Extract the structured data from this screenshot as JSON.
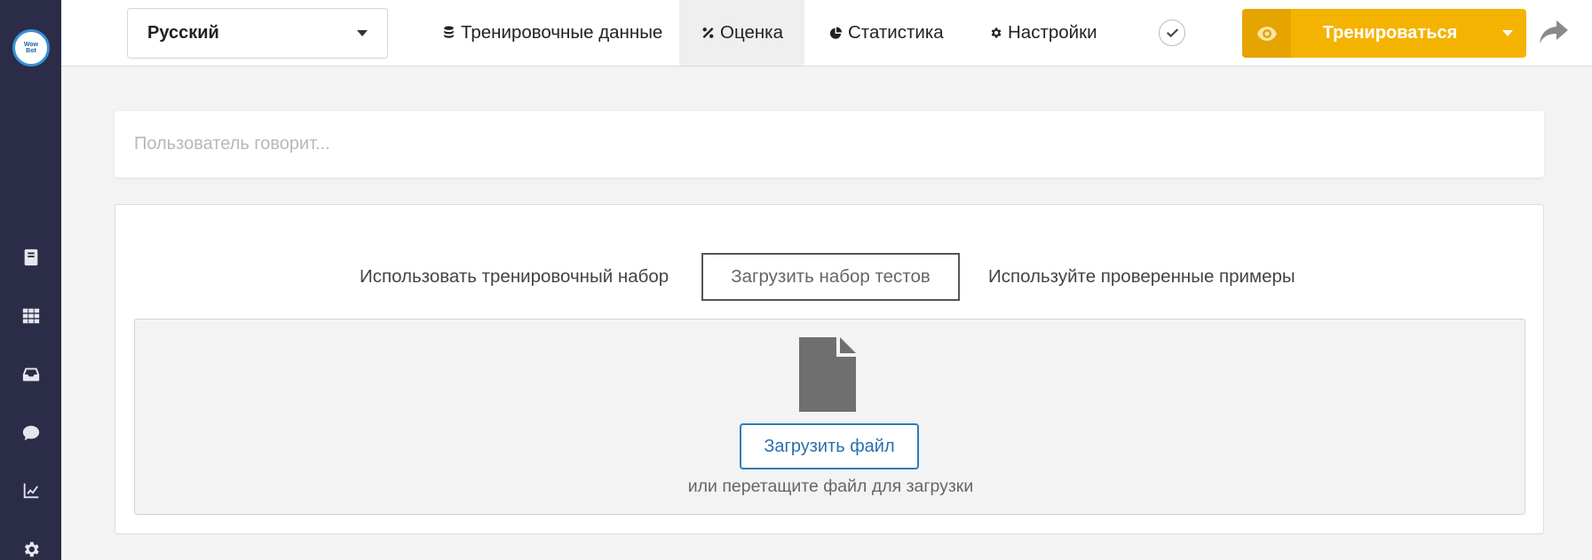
{
  "sidebar": {
    "logo_text": "Wow Bot",
    "items": [
      {
        "icon": "book-icon"
      },
      {
        "icon": "grid-icon"
      },
      {
        "icon": "inbox-icon"
      },
      {
        "icon": "chat-icon"
      },
      {
        "icon": "chart-icon"
      },
      {
        "icon": "gear-icon"
      }
    ]
  },
  "header": {
    "language": "Русский",
    "tabs": [
      {
        "label": "Тренировочные данные",
        "icon": "database-icon"
      },
      {
        "label": "Оценка",
        "icon": "percent-icon",
        "active": true
      },
      {
        "label": "Статистика",
        "icon": "pie-chart-icon"
      },
      {
        "label": "Настройки",
        "icon": "gear-icon"
      }
    ],
    "train_button": "Тренироваться"
  },
  "utterance": {
    "placeholder": "Пользователь говорит..."
  },
  "evaluation": {
    "options": [
      {
        "label": "Использовать тренировочный набор"
      },
      {
        "label": "Загрузить набор тестов",
        "selected": true
      },
      {
        "label": "Используйте проверенные примеры"
      }
    ],
    "upload_button": "Загрузить файл",
    "drop_hint": "или перетащите файл для загрузки"
  },
  "colors": {
    "sidebar": "#2b2c48",
    "accent": "#f5b301",
    "link": "#2f7bb8"
  }
}
